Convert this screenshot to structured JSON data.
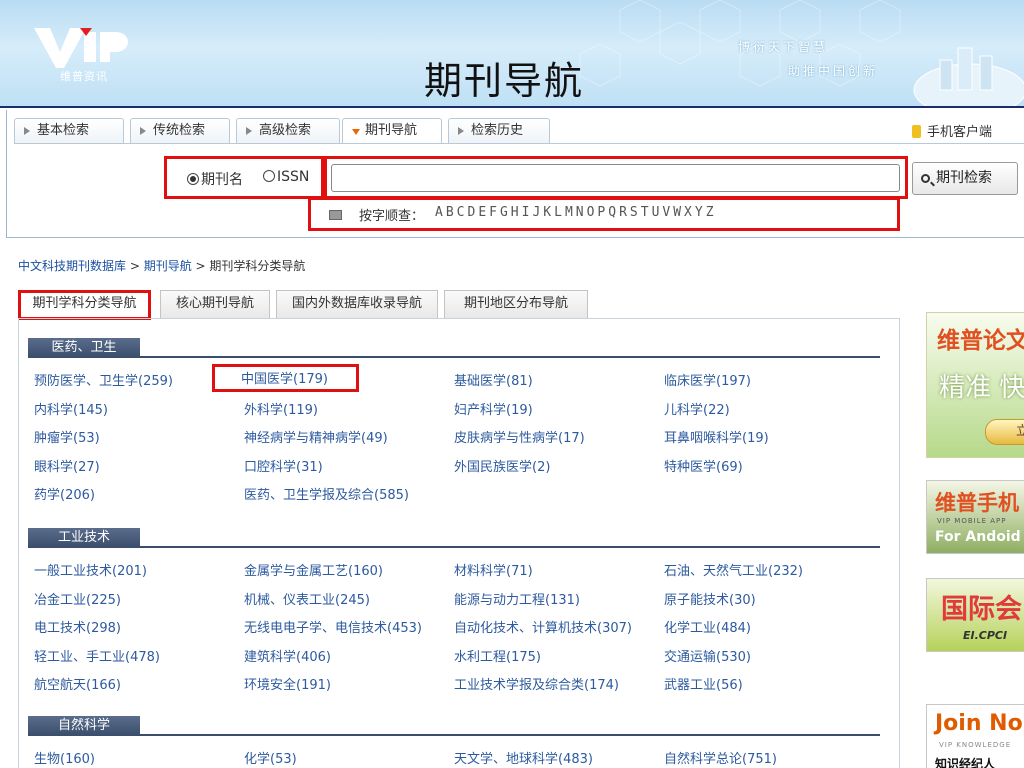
{
  "header": {
    "logo_text": "维普资讯",
    "title": "期刊导航",
    "slogan_line1": "博衍天下智慧",
    "slogan_line2": "助推中国创新"
  },
  "search_tabs": [
    {
      "label": "基本检索",
      "active": false
    },
    {
      "label": "传统检索",
      "active": false
    },
    {
      "label": "高级检索",
      "active": false
    },
    {
      "label": "期刊导航",
      "active": true
    },
    {
      "label": "检索历史",
      "active": false
    }
  ],
  "mobile_client": "手机客户端",
  "search": {
    "radio_journal_name": "期刊名",
    "radio_issn": "ISSN",
    "input_value": "",
    "button_label": "期刊检索"
  },
  "alphabet": {
    "label": "按字顺查：",
    "letters": [
      "A",
      "B",
      "C",
      "D",
      "E",
      "F",
      "G",
      "H",
      "I",
      "J",
      "K",
      "L",
      "M",
      "N",
      "O",
      "P",
      "Q",
      "R",
      "S",
      "T",
      "U",
      "V",
      "W",
      "X",
      "Y",
      "Z"
    ]
  },
  "breadcrumb": {
    "part1": "中文科技期刊数据库",
    "sep1": " > ",
    "part2": "期刊导航",
    "sep2": " > ",
    "part3": "期刊学科分类导航"
  },
  "nav_tabs": [
    {
      "label": "期刊学科分类导航",
      "active": true
    },
    {
      "label": "核心期刊导航",
      "active": false
    },
    {
      "label": "国内外数据库收录导航",
      "active": false
    },
    {
      "label": "期刊地区分布导航",
      "active": false
    }
  ],
  "categories": [
    {
      "name": "医药、卫生",
      "items": [
        "预防医学、卫生学(259)",
        "中国医学(179)",
        "基础医学(81)",
        "临床医学(197)",
        "内科学(145)",
        "外科学(119)",
        "妇产科学(19)",
        "儿科学(22)",
        "肿瘤学(53)",
        "神经病学与精神病学(49)",
        "皮肤病学与性病学(17)",
        "耳鼻咽喉科学(19)",
        "眼科学(27)",
        "口腔科学(31)",
        "外国民族医学(2)",
        "特种医学(69)",
        "药学(206)",
        "医药、卫生学报及综合(585)"
      ]
    },
    {
      "name": "工业技术",
      "items": [
        "一般工业技术(201)",
        "金属学与金属工艺(160)",
        "材料科学(71)",
        "石油、天然气工业(232)",
        "冶金工业(225)",
        "机械、仪表工业(245)",
        "能源与动力工程(131)",
        "原子能技术(30)",
        "电工技术(298)",
        "无线电电子学、电信技术(453)",
        "自动化技术、计算机技术(307)",
        "化学工业(484)",
        "轻工业、手工业(478)",
        "建筑科学(406)",
        "水利工程(175)",
        "交通运输(530)",
        "航空航天(166)",
        "环境安全(191)",
        "工业技术学报及综合类(174)",
        "武器工业(56)"
      ]
    },
    {
      "name": "自然科学",
      "items": [
        "生物(160)",
        "化学(53)",
        "天文学、地球科学(483)",
        "自然科学总论(751)"
      ]
    }
  ],
  "ads": {
    "ad1_line1": "维普论文",
    "ad1_line2": "精准 快",
    "ad1_button": "立",
    "ad2_line1": "维普手机",
    "ad2_line2": "VIP MOBILE APP",
    "ad2_line3": "For Andoid",
    "ad3_line1": "国际会",
    "ad3_line2": "EI.CPCI",
    "ad4_line1": "Join No",
    "ad4_line2": "VIP KNOWLEDGE",
    "ad4_line3": "知识经纪人"
  },
  "colors": {
    "highlight_red": "#e01010",
    "link_blue": "#2d5a9e",
    "category_bar": "#3a4d6b"
  }
}
